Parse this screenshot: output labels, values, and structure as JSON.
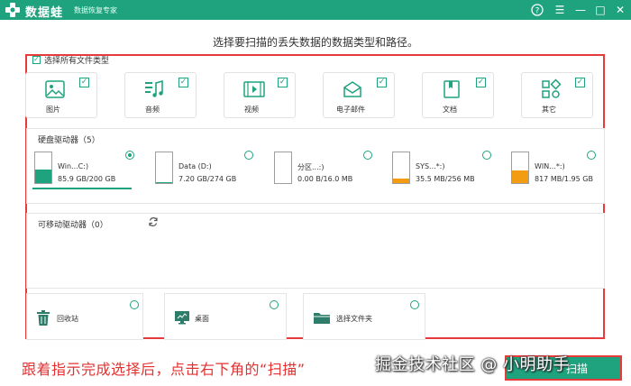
{
  "titlebar": {
    "app_name": "数据蛙",
    "subtitle": "数据恢复专家",
    "help": "?",
    "menu": "☰",
    "minimize": "—",
    "maximize": "□",
    "close": "✕"
  },
  "prompt": "选择要扫描的丢失数据的数据类型和路径。",
  "select_all_label": "选择所有文件类型",
  "file_types": [
    {
      "label": "图片",
      "icon": "image-icon",
      "checked": true
    },
    {
      "label": "音频",
      "icon": "music-icon",
      "checked": true
    },
    {
      "label": "视频",
      "icon": "video-icon",
      "checked": true
    },
    {
      "label": "电子邮件",
      "icon": "email-icon",
      "checked": true
    },
    {
      "label": "文档",
      "icon": "document-icon",
      "checked": true
    },
    {
      "label": "其它",
      "icon": "other-icon",
      "checked": true
    }
  ],
  "hdd_section_title": "硬盘驱动器（5）",
  "drives": [
    {
      "name": "Win...C:)",
      "size": "85.9 GB/200 GB",
      "fill": 0.43,
      "fill_color": "#1fa37e",
      "selected": true
    },
    {
      "name": "Data (D:)",
      "size": "7.20 GB/274 GB",
      "fill": 0.03,
      "fill_color": "#1fa37e",
      "selected": false
    },
    {
      "name": "分区...:)",
      "size": "0.00  B/16.0 MB",
      "fill": 0.0,
      "fill_color": "#1fa37e",
      "selected": false
    },
    {
      "name": "SYS...*:)",
      "size": "35.5 MB/256 MB",
      "fill": 0.14,
      "fill_color": "#f39c12",
      "selected": false
    },
    {
      "name": "WIN...*:)",
      "size": "817 MB/1.95 GB",
      "fill": 0.42,
      "fill_color": "#f39c12",
      "selected": false
    }
  ],
  "removable_section_title": "可移动驱动器（0）",
  "locations": [
    {
      "label": "回收站",
      "icon": "recycle-bin-icon"
    },
    {
      "label": "桌面",
      "icon": "desktop-icon"
    },
    {
      "label": "选择文件夹",
      "icon": "folder-icon"
    }
  ],
  "caption": "跟着指示完成选择后，点击右下角的“扫描”",
  "watermark": "掘金技术社区 @ 小明助手",
  "scan_button_label": "扫描",
  "colors": {
    "brand": "#1fa37e",
    "highlight": "#e63b3b",
    "warning": "#f39c12"
  }
}
